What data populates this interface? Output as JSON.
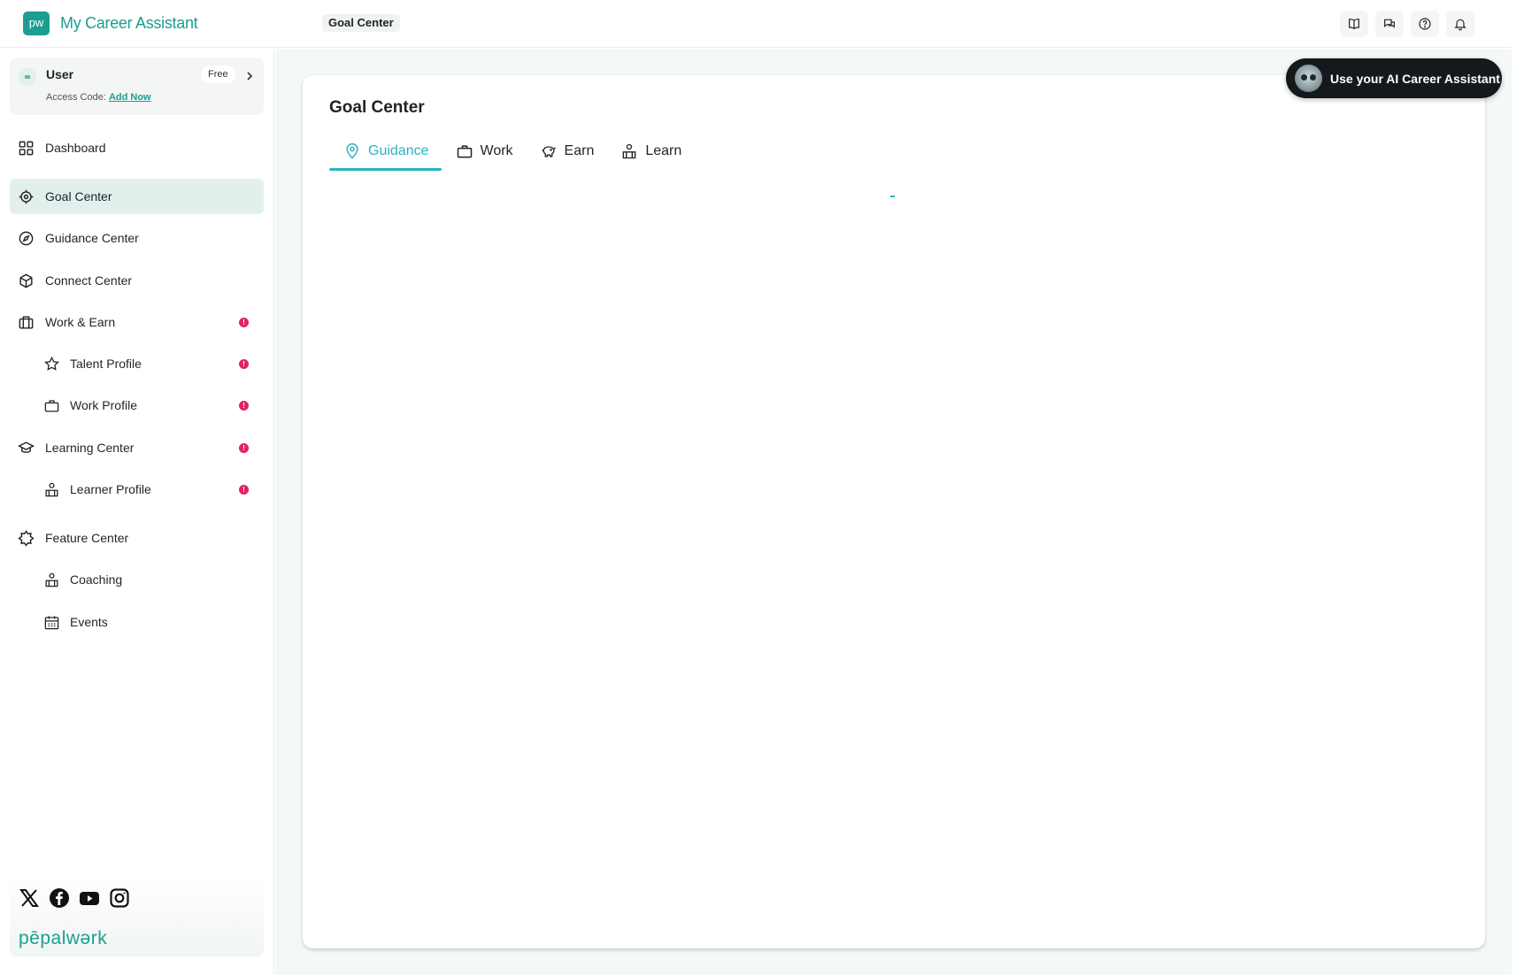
{
  "app": {
    "logo_text": "pw",
    "title": "My Career Assistant"
  },
  "breadcrumb": "Goal Center",
  "header_icons": [
    "book-icon",
    "chat-icon",
    "help-icon",
    "bell-icon"
  ],
  "user": {
    "name": "User",
    "plan": "Free",
    "access_label": "Access Code:",
    "access_link": "Add Now"
  },
  "sidebar": {
    "items": [
      {
        "label": "Dashboard",
        "icon": "grid-icon"
      },
      {
        "label": "Goal Center",
        "icon": "target-icon",
        "active": true
      },
      {
        "label": "Guidance Center",
        "icon": "compass-icon"
      },
      {
        "label": "Connect Center",
        "icon": "cube-icon"
      },
      {
        "label": "Work & Earn",
        "icon": "briefcase-icon",
        "alert": "!"
      },
      {
        "label": "Talent Profile",
        "icon": "star-icon",
        "alert": "!"
      },
      {
        "label": "Work Profile",
        "icon": "bag-icon",
        "alert": "!"
      },
      {
        "label": "Learning Center",
        "icon": "graduation-cap-icon",
        "alert": "!"
      },
      {
        "label": "Learner Profile",
        "icon": "learner-icon",
        "alert": "!"
      },
      {
        "label": "Feature Center",
        "icon": "badge-icon"
      },
      {
        "label": "Coaching",
        "icon": "coaching-icon"
      },
      {
        "label": "Events",
        "icon": "calendar-icon"
      }
    ]
  },
  "social": [
    "x-icon",
    "facebook-icon",
    "youtube-icon",
    "instagram-icon"
  ],
  "brand": "pēpalwərk",
  "main": {
    "title": "Goal Center",
    "tabs": [
      {
        "label": "Guidance",
        "icon": "location-pin-icon",
        "active": true
      },
      {
        "label": "Work",
        "icon": "briefcase-icon"
      },
      {
        "label": "Earn",
        "icon": "piggy-bank-icon"
      },
      {
        "label": "Learn",
        "icon": "learner-icon"
      }
    ]
  },
  "ai_button": {
    "label": "Use your AI Career Assistant"
  },
  "colors": {
    "accent": "#1a9e91",
    "tab_accent": "#2bb3c3",
    "alert": "#e0245e",
    "active_bg": "#e1f0ec"
  }
}
